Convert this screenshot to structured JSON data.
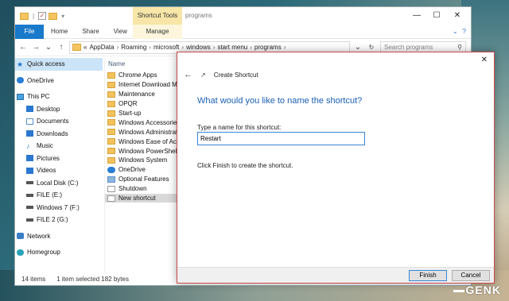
{
  "explorer": {
    "shortcut_tools": "Shortcut Tools",
    "title": "programs",
    "controls": {
      "minimize": "—",
      "maximize": "☐",
      "close": "✕"
    },
    "ribbon": {
      "file": "File",
      "home": "Home",
      "share": "Share",
      "view": "View",
      "manage": "Manage"
    },
    "address": {
      "crumbs": [
        "«",
        "AppData",
        "Roaming",
        "microsoft",
        "windows",
        "start menu",
        "programs"
      ]
    },
    "search_placeholder": "Search programs",
    "nav": [
      {
        "label": "Quick access",
        "icon": "star-icon"
      },
      {
        "label": "OneDrive",
        "icon": "onedrive-icon"
      },
      {
        "label": "This PC",
        "icon": "pc-icon"
      },
      {
        "label": "Desktop",
        "icon": "desktop-icon"
      },
      {
        "label": "Documents",
        "icon": "documents-icon"
      },
      {
        "label": "Downloads",
        "icon": "download-icon"
      },
      {
        "label": "Music",
        "icon": "music-icon"
      },
      {
        "label": "Pictures",
        "icon": "pictures-icon"
      },
      {
        "label": "Videos",
        "icon": "videos-icon"
      },
      {
        "label": "Local Disk (C:)",
        "icon": "drive-icon"
      },
      {
        "label": "FILE (E:)",
        "icon": "drive-icon"
      },
      {
        "label": "Windows 7 (F:)",
        "icon": "drive-icon"
      },
      {
        "label": "FILE 2 (G:)",
        "icon": "drive-icon"
      },
      {
        "label": "Network",
        "icon": "network-icon"
      },
      {
        "label": "Homegroup",
        "icon": "homegroup-icon"
      }
    ],
    "column_name": "Name",
    "files": [
      "Chrome Apps",
      "Internet Download Ma",
      "Maintenance",
      "OPQR",
      "Start-up",
      "Windows Accessories",
      "Windows Administrati",
      "Windows Ease of Acce",
      "Windows PowerShell",
      "Windows System",
      "OneDrive",
      "Optional Features",
      "Shutdown",
      "New shortcut"
    ],
    "status": {
      "count": "14 items",
      "selected": "1 item selected  182 bytes"
    }
  },
  "dialog": {
    "title": "Create Shortcut",
    "question": "What would you like to name the shortcut?",
    "label": "Type a name for this shortcut:",
    "value": "Restart",
    "hint": "Click Finish to create the shortcut.",
    "finish": "Finish",
    "cancel": "Cancel",
    "close": "✕"
  },
  "watermark": "GENK"
}
